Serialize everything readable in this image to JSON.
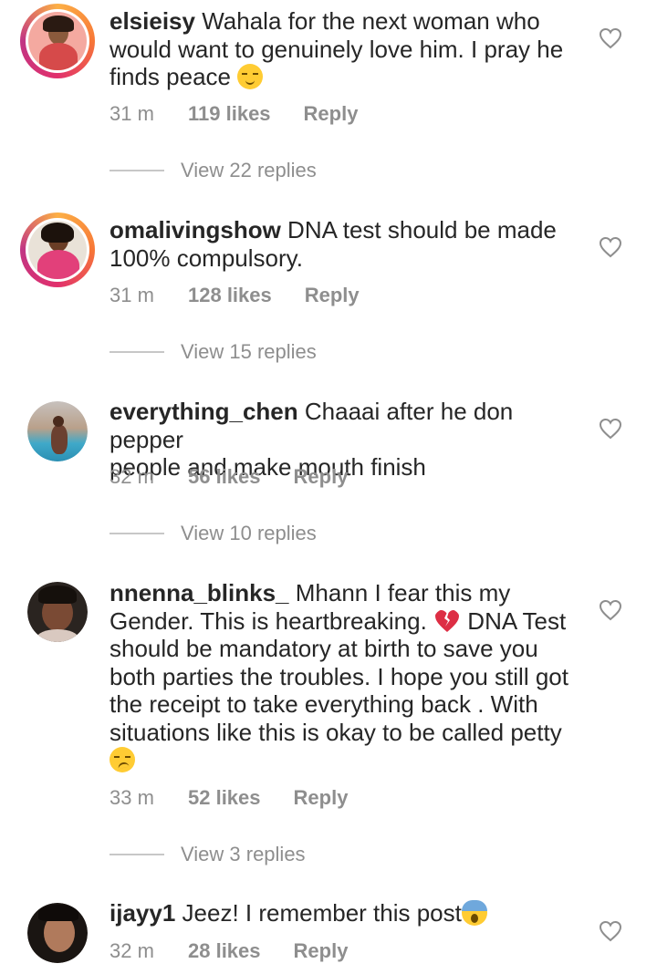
{
  "comments": [
    {
      "username": "elsieisy",
      "text_lines": [
        "Wahala for the next woman who",
        "would want to genuinely love him. I pray he",
        "finds peace"
      ],
      "emoji": "pensive-face",
      "time": "31 m",
      "likes": "119 likes",
      "reply": "Reply",
      "view_replies": "View 22 replies"
    },
    {
      "username": "omalivingshow",
      "text_lines": [
        "DNA test should be made",
        "100% compulsory."
      ],
      "time": "31 m",
      "likes": "128 likes",
      "reply": "Reply",
      "view_replies": "View 15 replies"
    },
    {
      "username": "everything_chen",
      "text_lines": [
        "Chaaai after he don pepper",
        "people and make mouth finish"
      ],
      "time": "32 m",
      "likes": "56 likes",
      "reply": "Reply",
      "view_replies": "View 10 replies"
    },
    {
      "username": "nnenna_blinks_",
      "text_lines": [
        "Mhann I fear this my",
        "Gender. This is heartbreaking.",
        "DNA Test",
        "should be mandatory at birth to save you",
        "both parties the troubles. I hope you still got",
        "the receipt to take everything back . With",
        "situations like this is okay to be called petty"
      ],
      "emojis": [
        "broken-heart",
        "smirking-face"
      ],
      "time": "33 m",
      "likes": "52 likes",
      "reply": "Reply",
      "view_replies": "View 3 replies"
    },
    {
      "username": "ijayy1",
      "text_lines": [
        "Jeez! I remember this post"
      ],
      "emoji": "face-screaming-in-fear",
      "time": "32 m",
      "likes": "28 likes",
      "reply": "Reply"
    }
  ],
  "icons": {
    "like": "heart-outline-icon"
  },
  "colors": {
    "text": "#262626",
    "secondary": "#8e8e8e",
    "divider": "#c7c7c7"
  }
}
